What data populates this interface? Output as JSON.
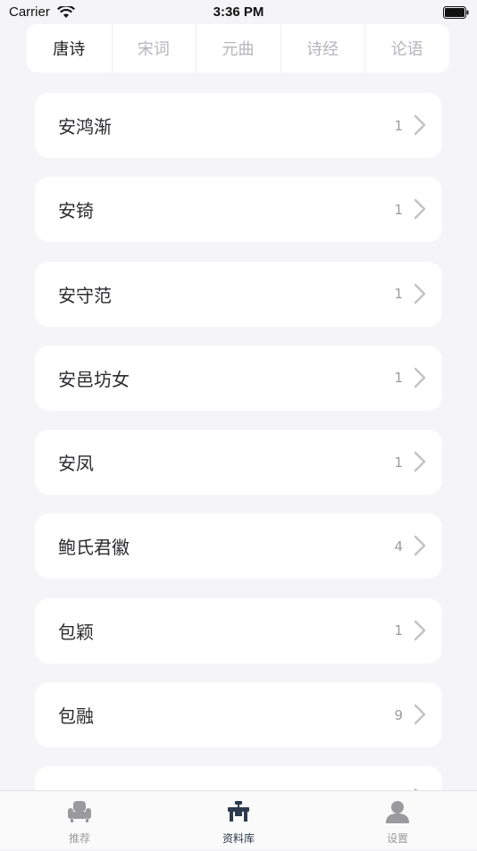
{
  "status": {
    "carrier": "Carrier",
    "time": "3:36 PM"
  },
  "tabs": [
    {
      "label": "唐诗",
      "active": true
    },
    {
      "label": "宋词",
      "active": false
    },
    {
      "label": "元曲",
      "active": false
    },
    {
      "label": "诗经",
      "active": false
    },
    {
      "label": "论语",
      "active": false
    }
  ],
  "authors": [
    {
      "name": "安鸿渐",
      "count": "1"
    },
    {
      "name": "安锜",
      "count": "1"
    },
    {
      "name": "安守范",
      "count": "1"
    },
    {
      "name": "安邑坊女",
      "count": "1"
    },
    {
      "name": "安凤",
      "count": "1"
    },
    {
      "name": "鲍氏君徽",
      "count": "4"
    },
    {
      "name": "包颖",
      "count": "1"
    },
    {
      "name": "包融",
      "count": "9"
    },
    {
      "name": "",
      "count": ""
    }
  ],
  "bottom_nav": [
    {
      "label": "推荐",
      "icon": "armchair-icon",
      "active": false
    },
    {
      "label": "资料库",
      "icon": "desk-icon",
      "active": true
    },
    {
      "label": "设置",
      "icon": "person-icon",
      "active": false
    }
  ]
}
